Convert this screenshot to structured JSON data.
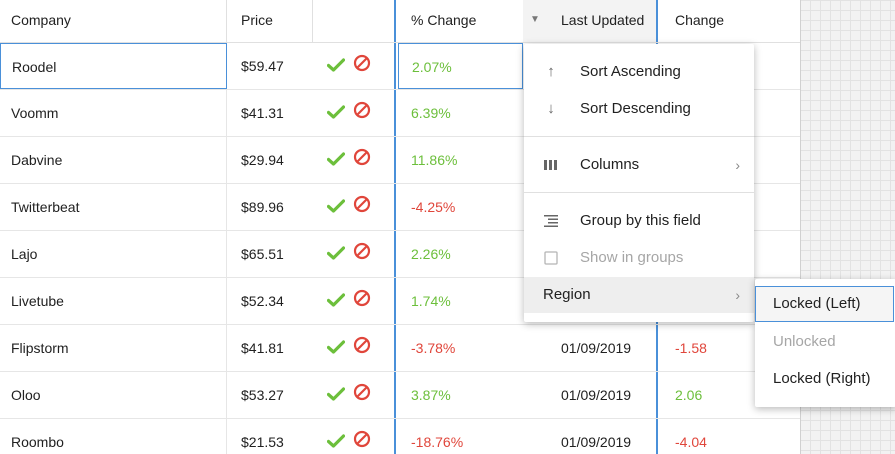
{
  "columns": {
    "company": "Company",
    "price": "Price",
    "actions": "",
    "pct_change": "% Change",
    "last_updated": "Last Updated",
    "change": "Change"
  },
  "rows": [
    {
      "company": "Roodel",
      "price": "$59.47",
      "pct": "2.07%",
      "pct_trend": "pos",
      "date": "",
      "change": "",
      "change_trend": ""
    },
    {
      "company": "Voomm",
      "price": "$41.31",
      "pct": "6.39%",
      "pct_trend": "pos",
      "date": "",
      "change": "",
      "change_trend": ""
    },
    {
      "company": "Dabvine",
      "price": "$29.94",
      "pct": "11.86%",
      "pct_trend": "pos",
      "date": "",
      "change": "",
      "change_trend": ""
    },
    {
      "company": "Twitterbeat",
      "price": "$89.96",
      "pct": "-4.25%",
      "pct_trend": "neg",
      "date": "",
      "change": "",
      "change_trend": ""
    },
    {
      "company": "Lajo",
      "price": "$65.51",
      "pct": "2.26%",
      "pct_trend": "pos",
      "date": "",
      "change": "",
      "change_trend": ""
    },
    {
      "company": "Livetube",
      "price": "$52.34",
      "pct": "1.74%",
      "pct_trend": "pos",
      "date": "",
      "change": "",
      "change_trend": ""
    },
    {
      "company": "Flipstorm",
      "price": "$41.81",
      "pct": "-3.78%",
      "pct_trend": "neg",
      "date": "01/09/2019",
      "change": "-1.58",
      "change_trend": "neg"
    },
    {
      "company": "Oloo",
      "price": "$53.27",
      "pct": "3.87%",
      "pct_trend": "pos",
      "date": "01/09/2019",
      "change": "2.06",
      "change_trend": "pos"
    },
    {
      "company": "Roombo",
      "price": "$21.53",
      "pct": "-18.76%",
      "pct_trend": "neg",
      "date": "01/09/2019",
      "change": "-4.04",
      "change_trend": "neg"
    }
  ],
  "column_menu": {
    "sort_ascending": "Sort Ascending",
    "sort_descending": "Sort Descending",
    "columns": "Columns",
    "group_by": "Group by this field",
    "show_in_groups": "Show in groups",
    "region": "Region"
  },
  "region_submenu": {
    "locked_left": "Locked (Left)",
    "unlocked": "Unlocked",
    "locked_right": "Locked (Right)"
  },
  "icons": {
    "sort_menu_trigger": "caret-down-icon",
    "sort_ascending": "arrow-up-icon",
    "sort_descending": "arrow-down-icon",
    "columns": "columns-icon",
    "group_by": "group-lines-icon",
    "show_in_groups": "checkbox-icon",
    "row_accept": "checkmark-icon",
    "row_reject": "ban-icon"
  },
  "colors": {
    "positive": "#6cbf3b",
    "negative": "#e0463b",
    "accent": "#4a90d9"
  }
}
